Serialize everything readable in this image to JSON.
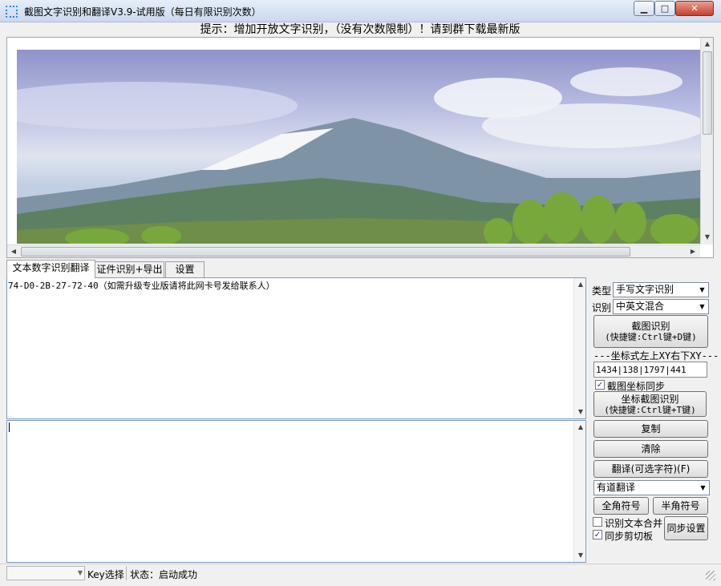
{
  "window": {
    "title": "截图文字识别和翻译V3.9-试用版（每日有限识别次数）",
    "minimize_glyph": "▁",
    "maximize_glyph": "□",
    "close_glyph": "✕"
  },
  "hint": "提示：增加开放文字识别，（没有次数限制）！请到群下载最新版",
  "tabs": [
    {
      "label": "文本数字识别翻译",
      "active": true
    },
    {
      "label": "证件识别+导出",
      "active": false
    },
    {
      "label": "设置",
      "active": false
    }
  ],
  "upper_text": "74-D0-2B-27-72-40（如需升级专业版请将此网卡号发给联系人）",
  "lower_text": "",
  "panel": {
    "type_label": "类型",
    "type_value": "手写文字识别",
    "recog_label": "识别",
    "recog_value": "中英文混合",
    "capture_btn_line1": "截图识别",
    "capture_btn_line2": "(快捷键:Ctrl键+D键)",
    "coord_header": "---坐标式左上XY右下XY---",
    "coord_value": "1434|138|1797|441",
    "sync_coord_label": "截图坐标同步",
    "sync_coord_checked": true,
    "coord_btn_line1": "坐标截图识别",
    "coord_btn_line2": "(快捷键:Ctrl键+T键)",
    "copy_btn": "复制",
    "clear_btn": "清除",
    "translate_btn": "翻译(可选字符)(F)",
    "translator_value": "有道翻译",
    "fullwidth_btn": "全角符号",
    "halfwidth_btn": "半角符号",
    "merge_label": "识别文本合并",
    "merge_checked": false,
    "sync_clip_label": "同步剪切板",
    "sync_clip_checked": true,
    "sync_settings_btn": "同步设置"
  },
  "status": {
    "combo_value": "",
    "key_label": "Key选择",
    "state_text": "状态：启动成功"
  },
  "glyphs": {
    "check": "✓",
    "dropdown": "▼",
    "up": "▲",
    "down": "▼",
    "left": "◀",
    "right": "▶"
  }
}
